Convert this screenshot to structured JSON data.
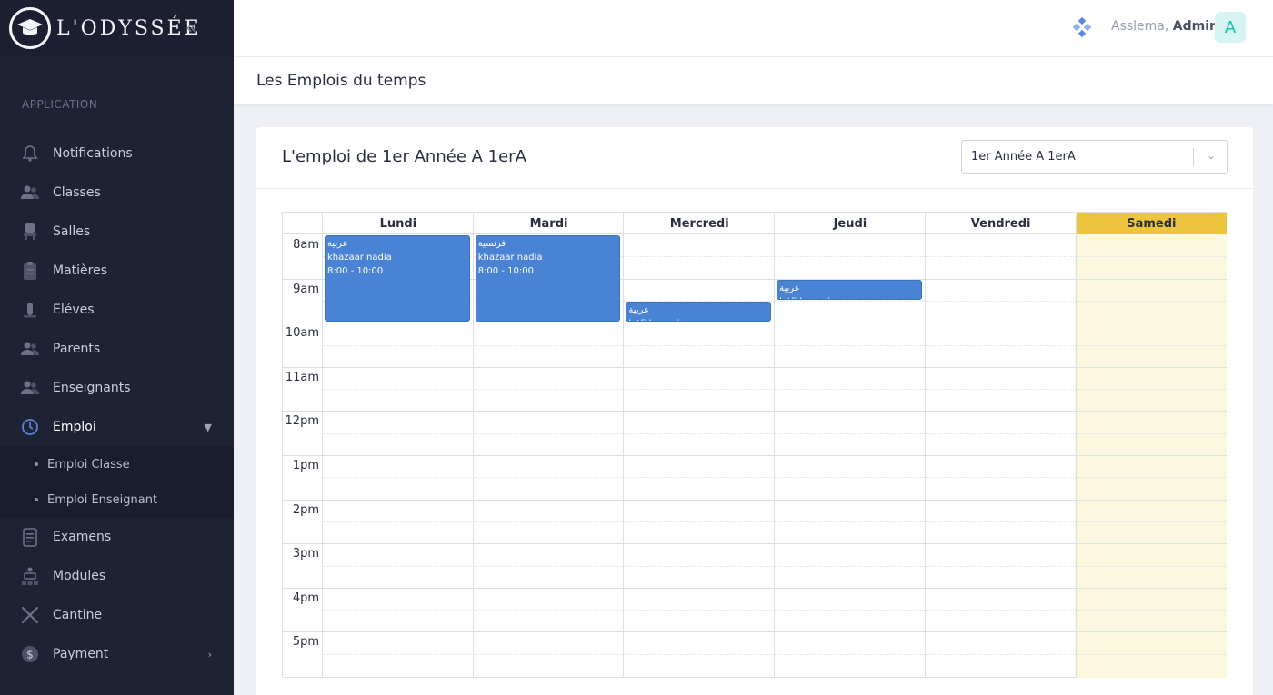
{
  "brand": {
    "name": "L'ODYSSÉE"
  },
  "sidebar": {
    "section": "APPLICATION",
    "items": [
      {
        "label": "Notifications",
        "icon": "bell-icon"
      },
      {
        "label": "Classes",
        "icon": "users-icon"
      },
      {
        "label": "Salles",
        "icon": "chair-icon"
      },
      {
        "label": "Matières",
        "icon": "clipboard-icon"
      },
      {
        "label": "Eléves",
        "icon": "student-icon"
      },
      {
        "label": "Parents",
        "icon": "parents-icon"
      },
      {
        "label": "Enseignants",
        "icon": "teachers-icon"
      },
      {
        "label": "Emploi",
        "icon": "clock-icon"
      },
      {
        "label": "Examens",
        "icon": "exam-icon"
      },
      {
        "label": "Modules",
        "icon": "modules-icon"
      },
      {
        "label": "Cantine",
        "icon": "cutlery-icon"
      },
      {
        "label": "Payment",
        "icon": "dollar-icon"
      }
    ],
    "sub_items": [
      {
        "label": "Emploi Classe"
      },
      {
        "label": "Emploi Enseignant"
      }
    ]
  },
  "header": {
    "greeting": "Asslema,",
    "user": "Admin",
    "avatar_letter": "A"
  },
  "page": {
    "title": "Les Emplois du temps"
  },
  "card": {
    "title": "L'emploi de 1er Année A 1erA",
    "select_value": "1er Année A 1erA"
  },
  "calendar": {
    "days": [
      "Lundi",
      "Mardi",
      "Mercredi",
      "Jeudi",
      "Vendredi",
      "Samedi"
    ],
    "times": [
      "8am",
      "9am",
      "10am",
      "11am",
      "12pm",
      "1pm",
      "2pm",
      "3pm",
      "4pm",
      "5pm"
    ],
    "highlight_color": "#ecc43d",
    "event_color": "#4a83d3",
    "events": [
      {
        "day": 0,
        "start": 8.0,
        "end": 10.0,
        "subject": "عربية",
        "teacher": "khazaar nadia",
        "time": "8:00 - 10:00"
      },
      {
        "day": 1,
        "start": 8.0,
        "end": 10.0,
        "subject": "فرنسية",
        "teacher": "khazaar nadia",
        "time": "8:00 - 10:00"
      },
      {
        "day": 2,
        "start": 9.5,
        "end": 10.0,
        "subject": "عربية",
        "teacher": "lotfi hawari",
        "time": ""
      },
      {
        "day": 3,
        "start": 9.0,
        "end": 9.5,
        "subject": "عربية",
        "teacher": "lotfi hawari",
        "time": ""
      }
    ]
  }
}
